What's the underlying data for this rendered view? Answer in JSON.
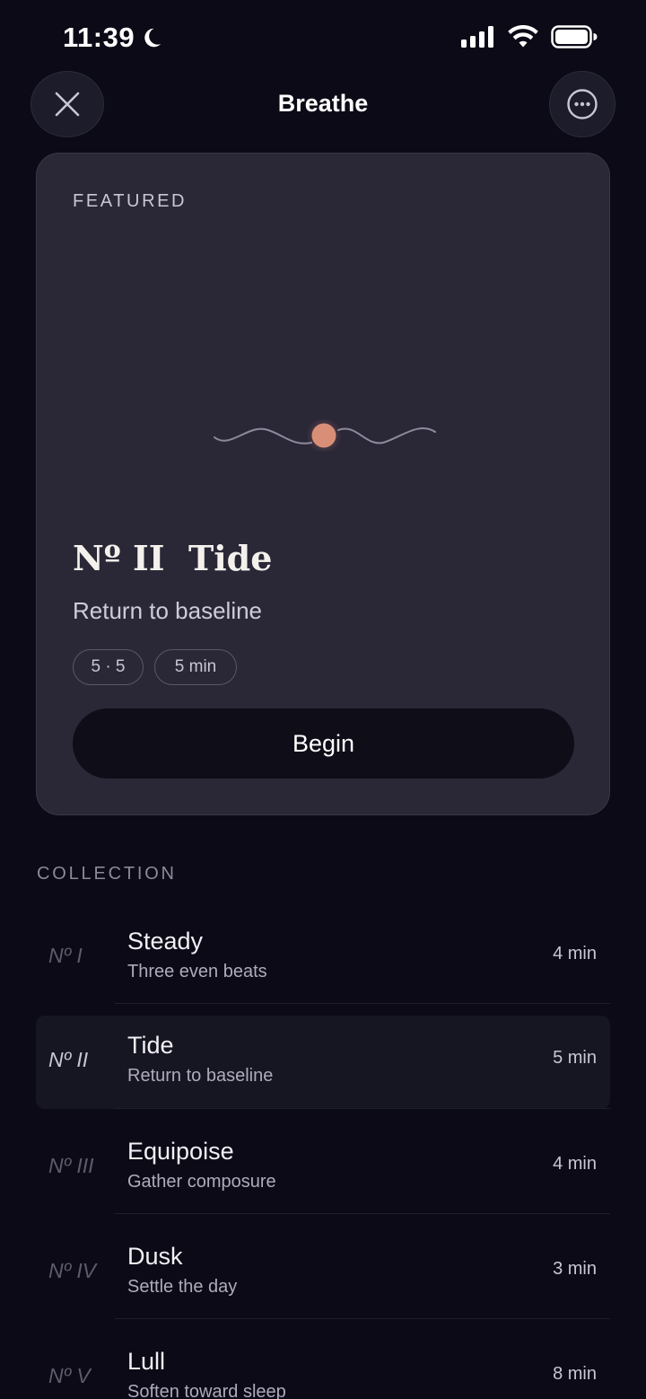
{
  "status_bar": {
    "time": "11:39",
    "icons": [
      "moon-icon",
      "cellular-signal-icon",
      "wifi-icon",
      "battery-icon"
    ]
  },
  "nav": {
    "title": "Breathe",
    "close_icon": "close-icon",
    "more_icon": "more-icon"
  },
  "featured": {
    "eyebrow": "FEATURED",
    "title": "Nº II  Tide",
    "subtitle": "Return to baseline",
    "chips": [
      "5 · 5",
      "5 min"
    ],
    "begin_label": "Begin",
    "accent_color": "#d98f77"
  },
  "collection": {
    "label": "COLLECTION",
    "items": [
      {
        "number": "Nº I",
        "title": "Steady",
        "subtitle": "Three even beats",
        "duration": "4 min"
      },
      {
        "number": "Nº II",
        "title": "Tide",
        "subtitle": "Return to baseline",
        "duration": "5 min",
        "selected": true
      },
      {
        "number": "Nº III",
        "title": "Equipoise",
        "subtitle": "Gather composure",
        "duration": "4 min"
      },
      {
        "number": "Nº IV",
        "title": "Dusk",
        "subtitle": "Settle the day",
        "duration": "3 min"
      },
      {
        "number": "Nº V",
        "title": "Lull",
        "subtitle": "Soften toward sleep",
        "duration": "8 min"
      }
    ]
  },
  "colors": {
    "background": "#0b0a16",
    "card": "#2a2737",
    "selected_row": "#161522"
  }
}
